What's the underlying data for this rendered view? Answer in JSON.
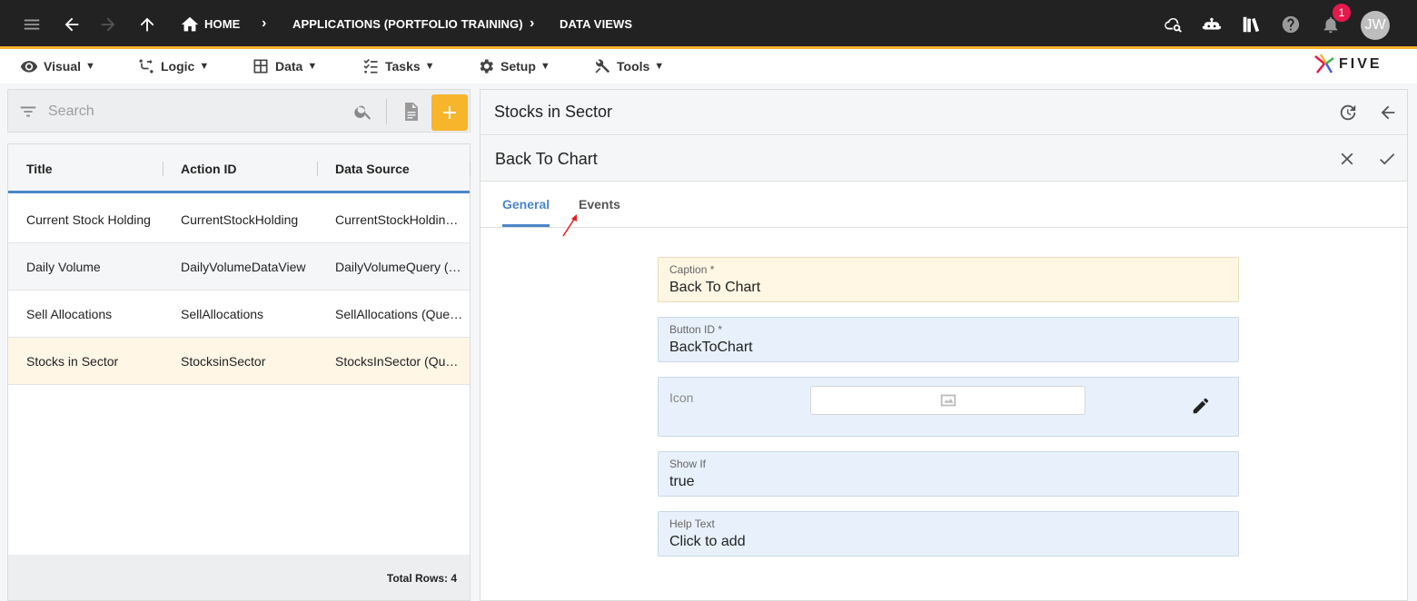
{
  "topbar": {
    "breadcrumbs": [
      "HOME",
      "APPLICATIONS (PORTFOLIO TRAINING)",
      "DATA VIEWS"
    ],
    "notification_count": "1",
    "avatar_initials": "JW"
  },
  "menubar": {
    "items": [
      {
        "label": "Visual",
        "icon": "eye-icon"
      },
      {
        "label": "Logic",
        "icon": "logic-icon"
      },
      {
        "label": "Data",
        "icon": "table-icon"
      },
      {
        "label": "Tasks",
        "icon": "checklist-icon"
      },
      {
        "label": "Setup",
        "icon": "gear-icon"
      },
      {
        "label": "Tools",
        "icon": "tools-icon"
      }
    ],
    "caret": "▼",
    "logo_text": "FIVE"
  },
  "list": {
    "search_placeholder": "Search",
    "columns": [
      "Title",
      "Action ID",
      "Data Source"
    ],
    "rows": [
      {
        "title": "Current Stock Holding",
        "action_id": "CurrentStockHolding",
        "data_source": "CurrentStockHolding (Query)"
      },
      {
        "title": "Daily Volume",
        "action_id": "DailyVolumeDataView",
        "data_source": "DailyVolumeQuery (Query)"
      },
      {
        "title": "Sell Allocations",
        "action_id": "SellAllocations",
        "data_source": "SellAllocations (Query)"
      },
      {
        "title": "Stocks in Sector",
        "action_id": "StocksinSector",
        "data_source": "StocksInSector (Query)"
      }
    ],
    "total_rows": "Total Rows: 4"
  },
  "detail": {
    "title": "Stocks in Sector",
    "form_title": "Back To Chart",
    "tabs": [
      "General",
      "Events"
    ],
    "fields": {
      "caption": {
        "label": "Caption *",
        "value": "Back To Chart"
      },
      "button_id": {
        "label": "Button ID *",
        "value": "BackToChart"
      },
      "icon": {
        "label": "Icon"
      },
      "show_if": {
        "label": "Show If",
        "value": "true"
      },
      "help_text": {
        "label": "Help Text",
        "value": "Click to add"
      }
    }
  },
  "colors": {
    "accent": "#f7b52c",
    "tab_active": "#4a86c8",
    "topbar": "#222222",
    "badge": "#e6194b"
  }
}
